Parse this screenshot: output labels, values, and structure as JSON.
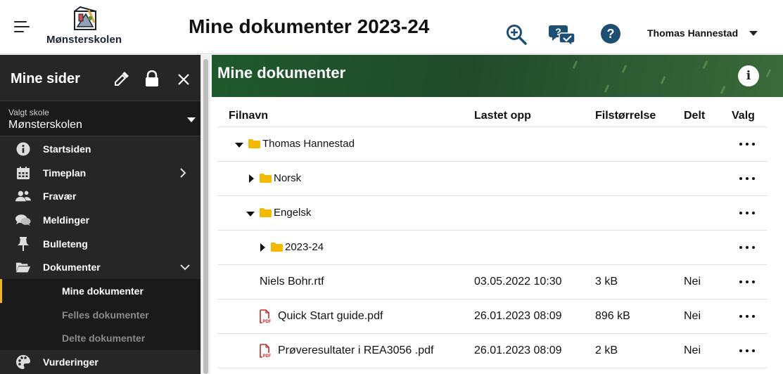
{
  "header": {
    "logo_text": "Mønsterskolen",
    "page_title": "Mine dokumenter 2023-24",
    "user_name": "Thomas Hannestad",
    "icons": [
      "menu-icon",
      "zoom-in-icon",
      "chat-question-icon",
      "help-icon",
      "caret-down-icon"
    ]
  },
  "sidebar": {
    "title": "Mine sider",
    "school_label": "Valgt skole",
    "school_value": "Mønsterskolen",
    "items": [
      {
        "label": "Startsiden",
        "icon": "info-icon"
      },
      {
        "label": "Timeplan",
        "icon": "calendar-icon"
      },
      {
        "label": "Fravær",
        "icon": "people-icon"
      },
      {
        "label": "Meldinger",
        "icon": "messages-icon"
      },
      {
        "label": "Bulleteng",
        "icon": "pin-icon"
      },
      {
        "label": "Dokumenter",
        "icon": "folder-open-icon"
      }
    ],
    "sub_items": [
      {
        "label": "Mine dokumenter",
        "active": true
      },
      {
        "label": "Felles dokumenter",
        "active": false
      },
      {
        "label": "Delte dokumenter",
        "active": false
      }
    ],
    "bottom_item": {
      "label": "Vurderinger",
      "icon": "palette-icon"
    }
  },
  "panel": {
    "title": "Mine dokumenter"
  },
  "table": {
    "columns": [
      "Filnavn",
      "Lastet opp",
      "Filstørrelse",
      "Delt",
      "Valg"
    ],
    "rows": [
      {
        "type": "folder",
        "name": "Thomas Hannestad",
        "uploaded": "",
        "size": "",
        "shared": "",
        "expanded": true
      },
      {
        "type": "folder",
        "name": "Norsk",
        "uploaded": "",
        "size": "",
        "shared": "",
        "expanded": false
      },
      {
        "type": "folder",
        "name": "Engelsk",
        "uploaded": "",
        "size": "",
        "shared": "",
        "expanded": true
      },
      {
        "type": "folder",
        "name": "2023-24",
        "uploaded": "",
        "size": "",
        "shared": "",
        "expanded": false
      },
      {
        "type": "file",
        "name": "Niels Bohr.rtf",
        "uploaded": "03.05.2022 10:30",
        "size": "3 kB",
        "shared": "Nei"
      },
      {
        "type": "pdf",
        "name": "Quick Start guide.pdf",
        "uploaded": "26.01.2023 08:09",
        "size": "896 kB",
        "shared": "Nei"
      },
      {
        "type": "pdf",
        "name": "Prøveresultater i REA3056 .pdf",
        "uploaded": "26.01.2023 08:09",
        "size": "2 kB",
        "shared": "Nei"
      }
    ]
  },
  "colors": {
    "accent_blue": "#1d4f73",
    "folder_yellow": "#f5b800",
    "pdf_red": "#c62828",
    "sidebar_bg": "#262626",
    "active_marker": "#f0b323",
    "panel_green": "#214a2b"
  }
}
